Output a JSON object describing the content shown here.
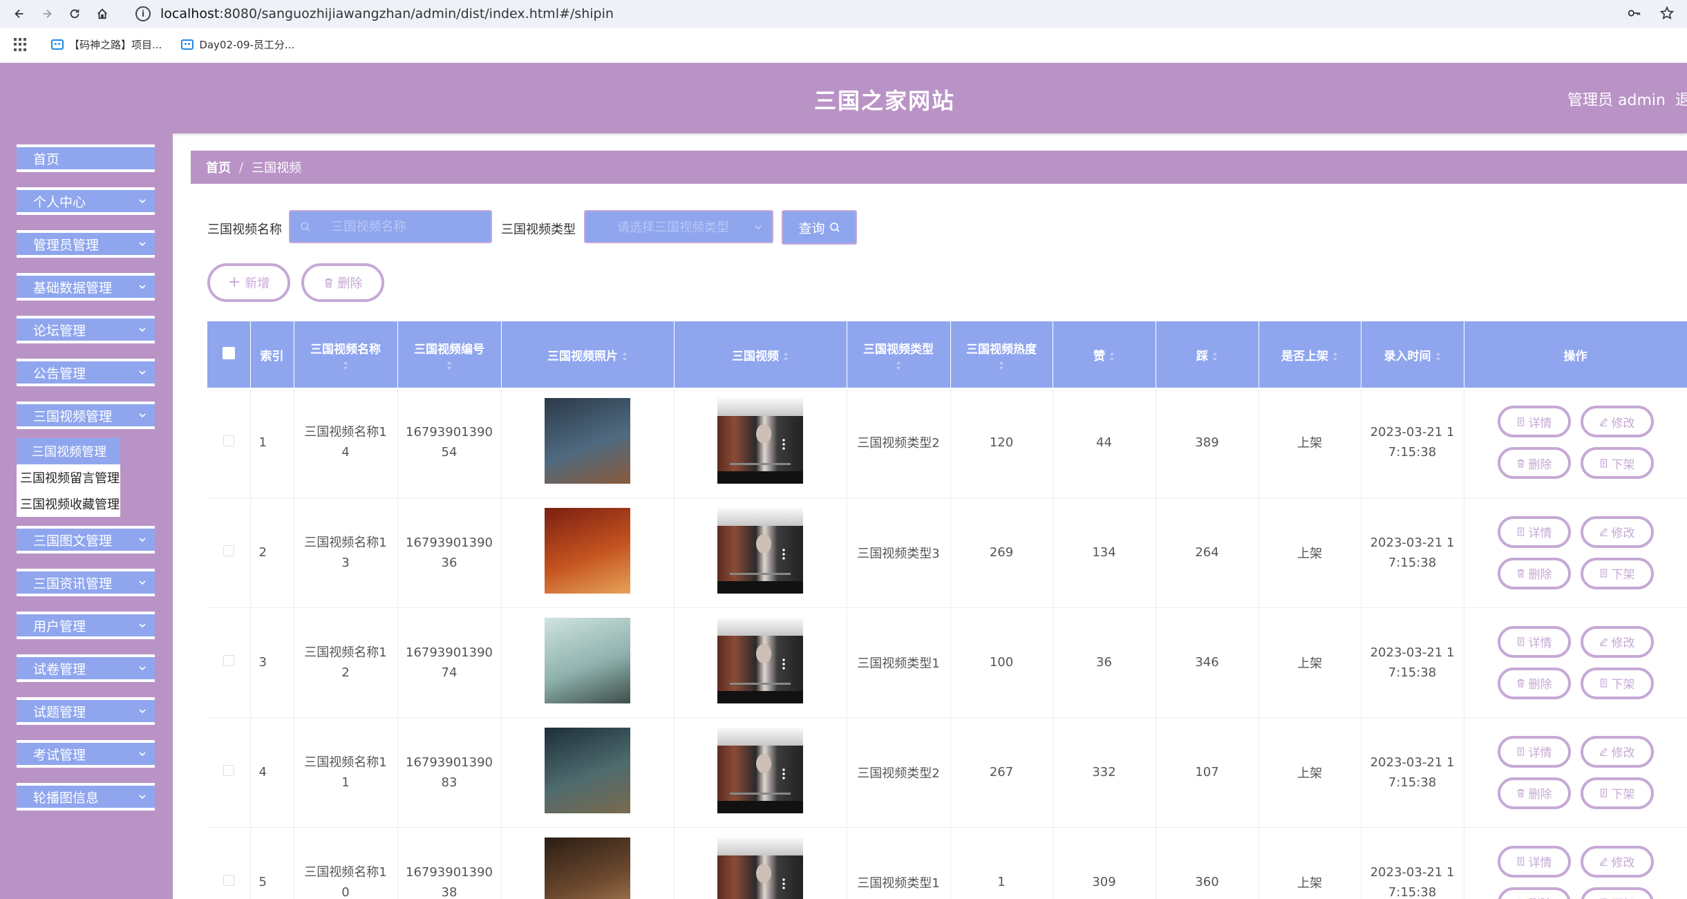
{
  "browser": {
    "url_host": "localhost",
    "url_rest": ":8080/sanguozhijiawangzhan/admin/dist/index.html#/shipin",
    "bookmarks": [
      "【码神之路】项目...",
      "Day02-09-员工分..."
    ]
  },
  "header": {
    "site_title": "三国之家网站",
    "admin_label": "管理员 admin",
    "logout_label": "退"
  },
  "sidebar": {
    "items": [
      {
        "label": "首页"
      },
      {
        "label": "个人中心"
      },
      {
        "label": "管理员管理"
      },
      {
        "label": "基础数据管理"
      },
      {
        "label": "论坛管理"
      },
      {
        "label": "公告管理"
      },
      {
        "label": "三国视频管理"
      },
      {
        "label": "三国图文管理"
      },
      {
        "label": "三国资讯管理"
      },
      {
        "label": "用户管理"
      },
      {
        "label": "试卷管理"
      },
      {
        "label": "试题管理"
      },
      {
        "label": "考试管理"
      },
      {
        "label": "轮播图信息"
      }
    ],
    "submenu": [
      "三国视频管理",
      "三国视频留言管理",
      "三国视频收藏管理"
    ]
  },
  "breadcrumb": {
    "home": "首页",
    "current": "三国视频"
  },
  "search": {
    "name_label": "三国视频名称",
    "name_placeholder": "三国视频名称",
    "type_label": "三国视频类型",
    "type_placeholder": "请选择三国视频类型",
    "query_label": "查询"
  },
  "actions": {
    "add_label": "新增",
    "delete_label": "删除"
  },
  "table": {
    "columns": [
      "索引",
      "三国视频名称",
      "三国视频编号",
      "三国视频照片",
      "三国视频",
      "三国视频类型",
      "三国视频热度",
      "赞",
      "踩",
      "是否上架",
      "录入时间",
      "操作"
    ],
    "op_labels": {
      "detail": "详情",
      "edit": "修改",
      "delete": "删除",
      "offshelf": "下架"
    },
    "rows": [
      {
        "index": "1",
        "name_a": "三国视频名称1",
        "name_b": "4",
        "code_a": "16793901390",
        "code_b": "54",
        "type": "三国视频类型2",
        "heat": "120",
        "likes": "44",
        "dislikes": "389",
        "status": "上架",
        "time_a": "2023-03-21 1",
        "time_b": "7:15:38",
        "photo_colors": [
          "#2c3a4a",
          "#4f6a80",
          "#8a5a3a"
        ]
      },
      {
        "index": "2",
        "name_a": "三国视频名称1",
        "name_b": "3",
        "code_a": "16793901390",
        "code_b": "36",
        "type": "三国视频类型3",
        "heat": "269",
        "likes": "134",
        "dislikes": "264",
        "status": "上架",
        "time_a": "2023-03-21 1",
        "time_b": "7:15:38",
        "photo_colors": [
          "#7a1f12",
          "#c4531f",
          "#e6a35a"
        ]
      },
      {
        "index": "3",
        "name_a": "三国视频名称1",
        "name_b": "2",
        "code_a": "16793901390",
        "code_b": "74",
        "type": "三国视频类型1",
        "heat": "100",
        "likes": "36",
        "dislikes": "346",
        "status": "上架",
        "time_a": "2023-03-21 1",
        "time_b": "7:15:38",
        "photo_colors": [
          "#cfe3e0",
          "#8fb2ad",
          "#3d4d4a"
        ]
      },
      {
        "index": "4",
        "name_a": "三国视频名称1",
        "name_b": "1",
        "code_a": "16793901390",
        "code_b": "83",
        "type": "三国视频类型2",
        "heat": "267",
        "likes": "332",
        "dislikes": "107",
        "status": "上架",
        "time_a": "2023-03-21 1",
        "time_b": "7:15:38",
        "photo_colors": [
          "#1d2f3a",
          "#4e6b6e",
          "#7a6a4c"
        ]
      },
      {
        "index": "5",
        "name_a": "三国视频名称1",
        "name_b": "0",
        "code_a": "16793901390",
        "code_b": "38",
        "type": "三国视频类型1",
        "heat": "1",
        "likes": "309",
        "dislikes": "360",
        "status": "上架",
        "time_a": "2023-03-21 1",
        "time_b": "7:15:38",
        "photo_colors": [
          "#2a1d14",
          "#6e4a2f",
          "#b68a5e"
        ]
      }
    ]
  },
  "colors": {
    "header": "#b993c6",
    "accent": "#8fa6ee",
    "pill": "#c6a9d6"
  }
}
